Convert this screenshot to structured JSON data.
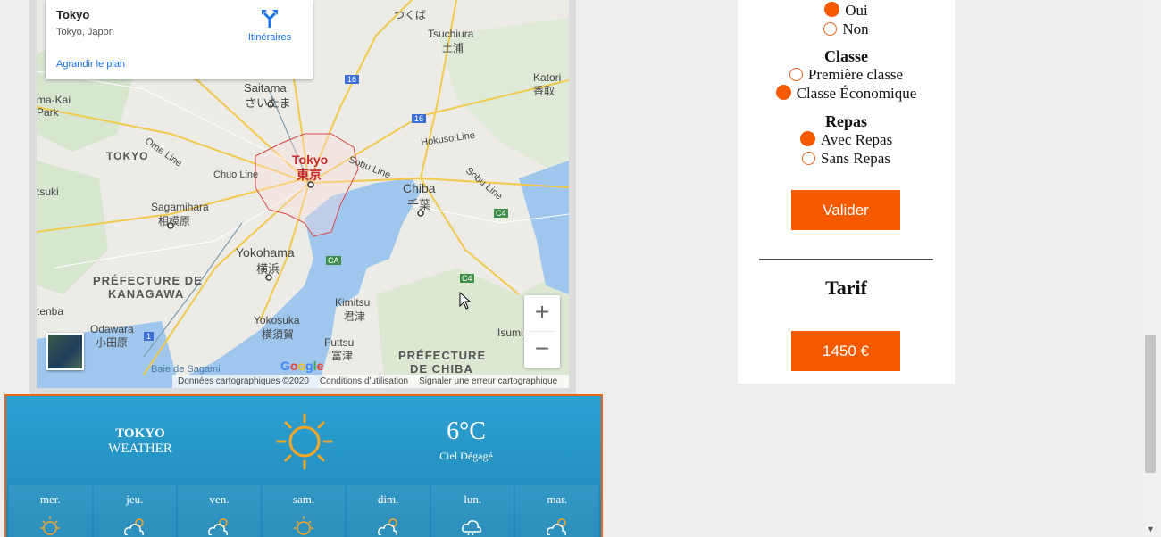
{
  "map": {
    "card": {
      "title": "Tokyo",
      "subtitle": "Tokyo, Japon",
      "directions_label": "Itinéraires",
      "enlarge_link": "Agrandir le plan"
    },
    "labels": {
      "saitama": "Saitama",
      "saitama_jp": "さいたま",
      "tokyo_big": "TOKYO",
      "tokyo_city": "Tokyo",
      "tokyo_jp": "東京",
      "chiba": "Chiba",
      "chiba_jp": "千葉",
      "yokohama": "Yokohama",
      "yokohama_jp": "横浜",
      "sagamihara": "Sagamihara",
      "sagamihara_jp": "相模原",
      "kanagawa1": "PRÉFECTURE DE",
      "kanagawa2": "KANAGAWA",
      "chiba_pref1": "PRÉFECTURE",
      "chiba_pref2": "DE CHIBA",
      "yokosuka": "Yokosuka",
      "yokosuka_jp": "横須賀",
      "kimitsu": "Kimitsu",
      "kimitsu_jp": "君津",
      "futtsu": "Futtsu",
      "futtsu_jp": "富津",
      "odawara": "Odawara",
      "odawara_jp": "小田原",
      "tsuchiura": "Tsuchiura",
      "tsuchiura_jp": "土浦",
      "katori": "Katori",
      "katori_jp": "香取",
      "tsukuba_jp": "つくば",
      "chuo_line": "Chuo Line",
      "ome_line": "Ome Line",
      "hokuso_line": "Hokuso Line",
      "sobu_line": "Sobu Line",
      "sobu_line2": "Sobu Line",
      "sagami_bay": "Baie de Sagami",
      "kai": "ma-Kai",
      "park": "Park",
      "tsuki": "tsuki",
      "tenba": "tenba",
      "isumi": "Isumi",
      "route_c4": "C4",
      "route_c4b": "C4",
      "route_ca": "CA",
      "route_1": "1",
      "route_16": "16",
      "route_16b": "16"
    },
    "google": "Google",
    "footer": {
      "data": "Données cartographiques ©2020",
      "terms": "Conditions d'utilisation",
      "report": "Signaler une erreur cartographique"
    },
    "zoom_in": "+",
    "zoom_out": "−"
  },
  "weather": {
    "city": "TOKYO",
    "subtitle": "WEATHER",
    "temperature": "6°C",
    "description": "Ciel Dégagé",
    "days": [
      {
        "name": "mer.",
        "icon": "sun-icon"
      },
      {
        "name": "jeu.",
        "icon": "partly-cloudy-icon"
      },
      {
        "name": "ven.",
        "icon": "partly-cloudy-icon"
      },
      {
        "name": "sam.",
        "icon": "sun-icon"
      },
      {
        "name": "dim.",
        "icon": "partly-cloudy-icon"
      },
      {
        "name": "lun.",
        "icon": "rain-cloud-icon"
      },
      {
        "name": "mar.",
        "icon": "partly-cloudy-icon"
      }
    ]
  },
  "form": {
    "option_yes": "Oui",
    "option_no": "Non",
    "class_heading": "Classe",
    "class_first": "Première classe",
    "class_economy": "Classe Économique",
    "meal_heading": "Repas",
    "meal_with": "Avec Repas",
    "meal_without": "Sans Repas",
    "submit": "Valider",
    "tarif_heading": "Tarif",
    "price": "1450 €",
    "selected": {
      "yesno": "Oui",
      "class": "Classe Économique",
      "meal": "Avec Repas"
    }
  },
  "colors": {
    "accent": "#f55a00",
    "weather_bg": "#2ea1d2",
    "link": "#1a73e8"
  }
}
